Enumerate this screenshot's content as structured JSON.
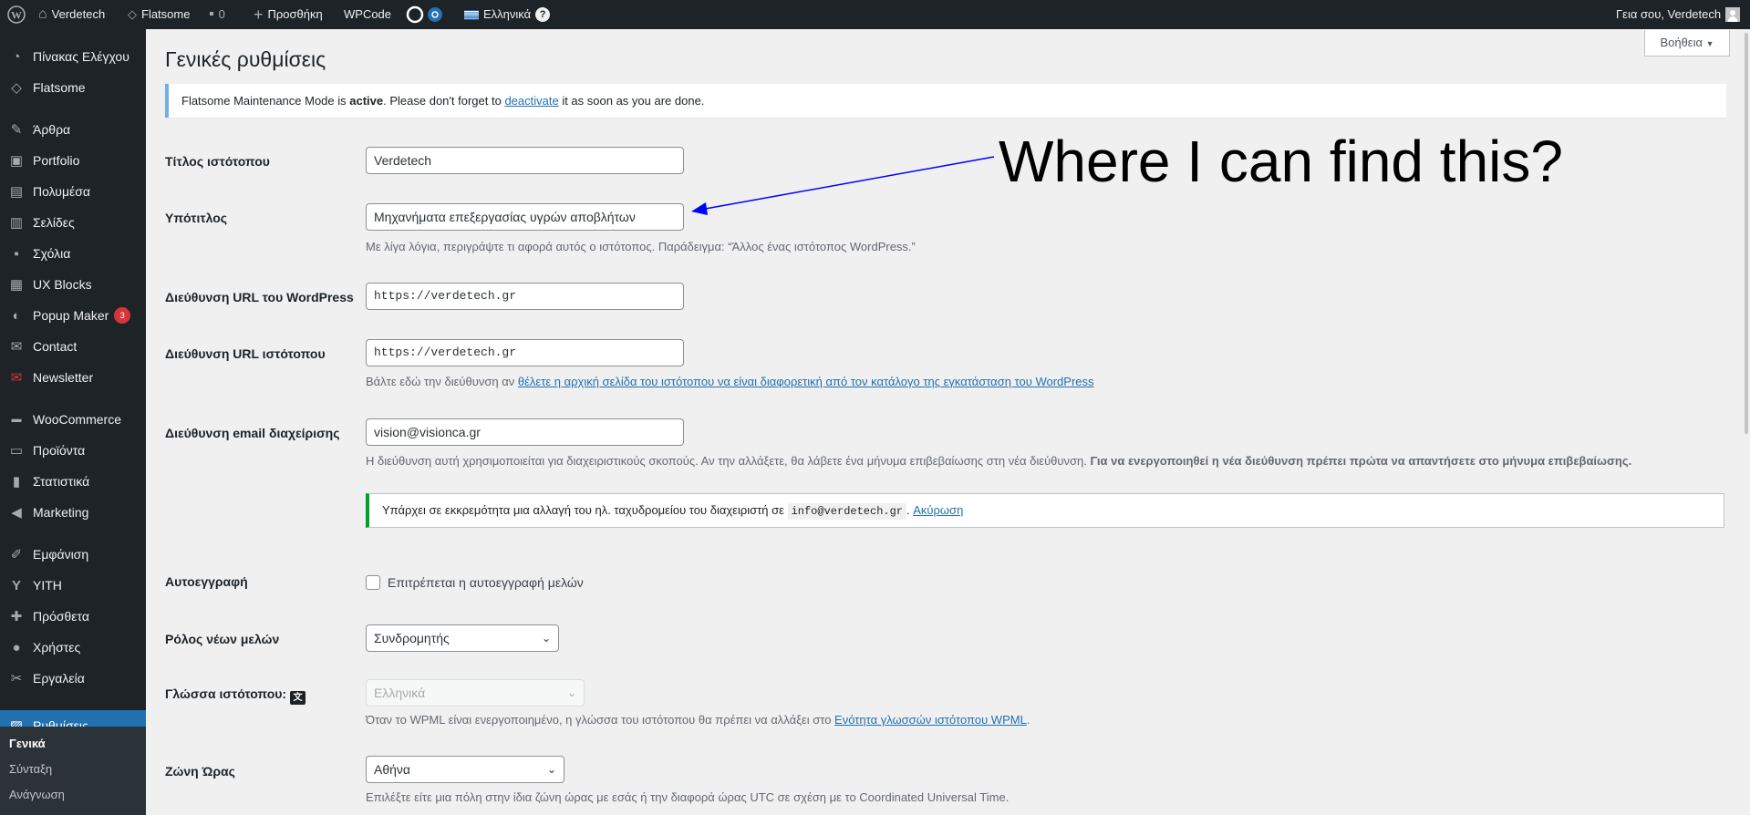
{
  "adminbar": {
    "site_name": "Verdetech",
    "theme": "Flatsome",
    "comments_count": "0",
    "new_label": "Προσθήκη",
    "wpcode": "WPCode",
    "language": "Ελληνικά",
    "greeting": "Γεια σου, Verdetech"
  },
  "sidebar": {
    "items": [
      {
        "label": "Πίνακας Ελέγχου",
        "icon": "dashboard-icon"
      },
      {
        "label": "Flatsome",
        "icon": "flatsome-icon"
      },
      {
        "label": "Άρθρα",
        "icon": "pin-icon"
      },
      {
        "label": "Portfolio",
        "icon": "portfolio-icon"
      },
      {
        "label": "Πολυμέσα",
        "icon": "media-icon"
      },
      {
        "label": "Σελίδες",
        "icon": "pages-icon"
      },
      {
        "label": "Σχόλια",
        "icon": "comments-icon"
      },
      {
        "label": "UX Blocks",
        "icon": "blocks-icon"
      },
      {
        "label": "Popup Maker",
        "icon": "popup-icon",
        "badge": "3"
      },
      {
        "label": "Contact",
        "icon": "mail-icon"
      },
      {
        "label": "Newsletter",
        "icon": "newsletter-icon"
      },
      {
        "label": "WooCommerce",
        "icon": "woo-icon"
      },
      {
        "label": "Προϊόντα",
        "icon": "products-icon"
      },
      {
        "label": "Στατιστικά",
        "icon": "stats-icon"
      },
      {
        "label": "Marketing",
        "icon": "marketing-icon"
      },
      {
        "label": "Εμφάνιση",
        "icon": "appearance-icon"
      },
      {
        "label": "YITH",
        "icon": "yith-icon"
      },
      {
        "label": "Πρόσθετα",
        "icon": "plugins-icon"
      },
      {
        "label": "Χρήστες",
        "icon": "users-icon"
      },
      {
        "label": "Εργαλεία",
        "icon": "tools-icon"
      },
      {
        "label": "Ρυθμίσεις",
        "icon": "settings-icon"
      }
    ],
    "submenu": [
      "Γενικά",
      "Σύνταξη",
      "Ανάγνωση"
    ]
  },
  "page": {
    "title": "Γενικές ρυθμίσεις",
    "help": "Βοήθεια",
    "notice_pre": "Flatsome Maintenance Mode is ",
    "notice_active": "active",
    "notice_mid": ". Please don't forget to ",
    "notice_link": "deactivate",
    "notice_post": " it as soon as you are done."
  },
  "form": {
    "site_title_label": "Τίτλος ιστότοπου",
    "site_title_value": "Verdetech",
    "tagline_label": "Υπότιτλος",
    "tagline_value": "Μηχανήματα επεξεργασίας υγρών αποβλήτων",
    "tagline_desc": "Με λίγα λόγια, περιγράψτε τι αφορά αυτός ο ιστότοπος. Παράδειγμα: “Άλλος ένας ιστότοπος WordPress.”",
    "wp_url_label": "Διεύθυνση URL του WordPress",
    "wp_url_value": "https://verdetech.gr",
    "site_url_label": "Διεύθυνση URL ιστότοπου",
    "site_url_value": "https://verdetech.gr",
    "site_url_desc_pre": "Βάλτε εδώ την διεύθυνση αν ",
    "site_url_desc_link": "θέλετε η αρχική σελίδα του ιστότοπου να είναι διαφορετική από τον κατάλογο της εγκατάσταση του WordPress",
    "email_label": "Διεύθυνση email διαχείρισης",
    "email_value": "vision@visionca.gr",
    "email_desc": "Η διεύθυνση αυτή χρησιμοποιείται για διαχειριστικούς σκοπούς. Αν την αλλάξετε, θα λάβετε ένα μήνυμα επιβεβαίωσης στη νέα διεύθυνση.",
    "email_desc_bold": "Για να ενεργοποιηθεί η νέα διεύθυνση πρέπει πρώτα να απαντήσετε στο μήνυμα επιβεβαίωσης.",
    "pending_pre": "Υπάρχει σε εκκρεμότητα μια αλλαγή του ηλ. ταχυδρομείου του διαχειριστή σε ",
    "pending_code": "info@verdetech.gr",
    "pending_sep": ". ",
    "pending_link": "Ακύρωση",
    "membership_label": "Αυτοεγγραφή",
    "membership_checkbox": "Επιτρέπεται η αυτοεγγραφή μελών",
    "role_label": "Ρόλος νέων μελών",
    "role_value": "Συνδρομητής",
    "lang_label": "Γλώσσα ιστότοπου:",
    "lang_value": "Ελληνικά",
    "lang_desc_pre": "Όταν το WPML είναι ενεργοποιημένο, η γλώσσα του ιστότοπου θα πρέπει να αλλάξει στο ",
    "lang_desc_link": "Ενότητα γλωσσών ιστότοπου WPML",
    "lang_desc_post": ".",
    "tz_label": "Ζώνη Ώρας",
    "tz_value": "Αθήνα",
    "tz_desc": "Επιλέξτε είτε μια πόλη στην ίδια ζώνη ώρας με εσάς ή την διαφορά ώρας UTC σε σχέση με το Coordinated Universal Time."
  },
  "annotation": {
    "text": "Where I can find this?",
    "color": "#0000ff"
  }
}
